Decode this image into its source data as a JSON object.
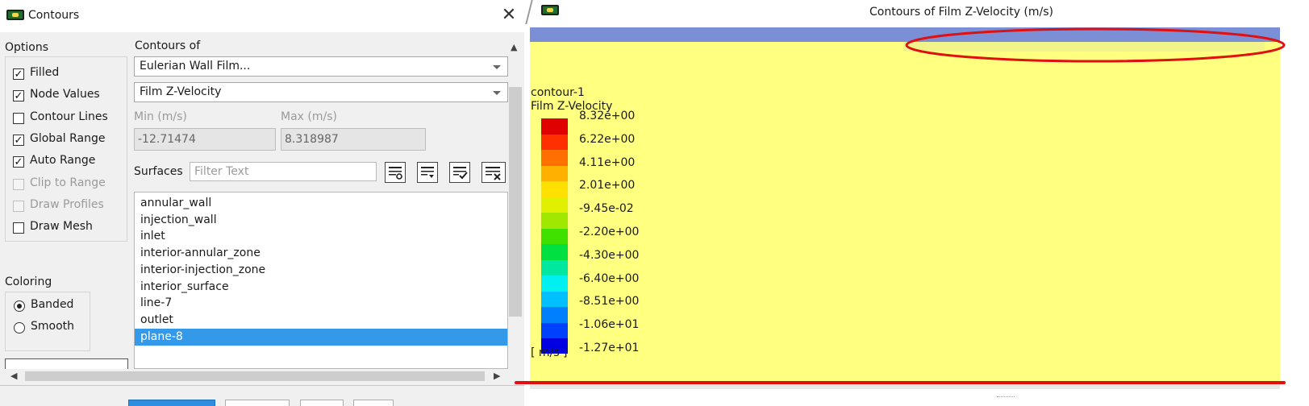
{
  "dialog": {
    "title": "Contours",
    "close_glyph": "✕",
    "icon": "app-logo-icon"
  },
  "options": {
    "label": "Options",
    "items": [
      {
        "label": "Filled",
        "checked": true,
        "enabled": true
      },
      {
        "label": "Node Values",
        "checked": true,
        "enabled": true
      },
      {
        "label": "Contour Lines",
        "checked": false,
        "enabled": true
      },
      {
        "label": "Global Range",
        "checked": true,
        "enabled": true
      },
      {
        "label": "Auto Range",
        "checked": true,
        "enabled": true
      },
      {
        "label": "Clip to Range",
        "checked": false,
        "enabled": false
      },
      {
        "label": "Draw Profiles",
        "checked": false,
        "enabled": false
      },
      {
        "label": "Draw Mesh",
        "checked": false,
        "enabled": true
      }
    ],
    "check_glyph": "✓"
  },
  "coloring": {
    "label": "Coloring",
    "items": [
      {
        "label": "Banded",
        "selected": true
      },
      {
        "label": "Smooth",
        "selected": false
      }
    ]
  },
  "contours_of": {
    "label": "Contours of",
    "category": "Eulerian Wall Film...",
    "variable": "Film Z-Velocity"
  },
  "range": {
    "min_label": "Min (m/s)",
    "max_label": "Max (m/s)",
    "min_value": "-12.71474",
    "max_value": "8.318987"
  },
  "surfaces": {
    "label": "Surfaces",
    "filter_placeholder": "Filter Text",
    "items": [
      {
        "name": "annular_wall",
        "selected": false
      },
      {
        "name": "injection_wall",
        "selected": false
      },
      {
        "name": "inlet",
        "selected": false
      },
      {
        "name": "interior-annular_zone",
        "selected": false
      },
      {
        "name": "interior-injection_zone",
        "selected": false
      },
      {
        "name": "interior_surface",
        "selected": false
      },
      {
        "name": "line-7",
        "selected": false
      },
      {
        "name": "outlet",
        "selected": false
      },
      {
        "name": "plane-8",
        "selected": true
      }
    ]
  },
  "graphics": {
    "title": "Contours of Film Z-Velocity (m/s)",
    "contour_name": "contour-1",
    "variable": "Film Z-Velocity",
    "units_label": "[ m/s ]",
    "colors": {
      "top_band": "#7b8fd6",
      "field": "#ffff80",
      "annotation": "#e01010"
    }
  },
  "legend": {
    "bands": [
      "#0000e0",
      "#0040ff",
      "#0080ff",
      "#00c0ff",
      "#00f0f0",
      "#00e8a0",
      "#00e040",
      "#40e000",
      "#a0e800",
      "#e0f000",
      "#ffe000",
      "#ffb000",
      "#ff7000",
      "#ff3000",
      "#e00000"
    ],
    "ticks": [
      "8.32e+00",
      "6.22e+00",
      "4.11e+00",
      "2.01e+00",
      "-9.45e-02",
      "-2.20e+00",
      "-4.30e+00",
      "-6.40e+00",
      "-8.51e+00",
      "-1.06e+01",
      "-1.27e+01"
    ]
  }
}
